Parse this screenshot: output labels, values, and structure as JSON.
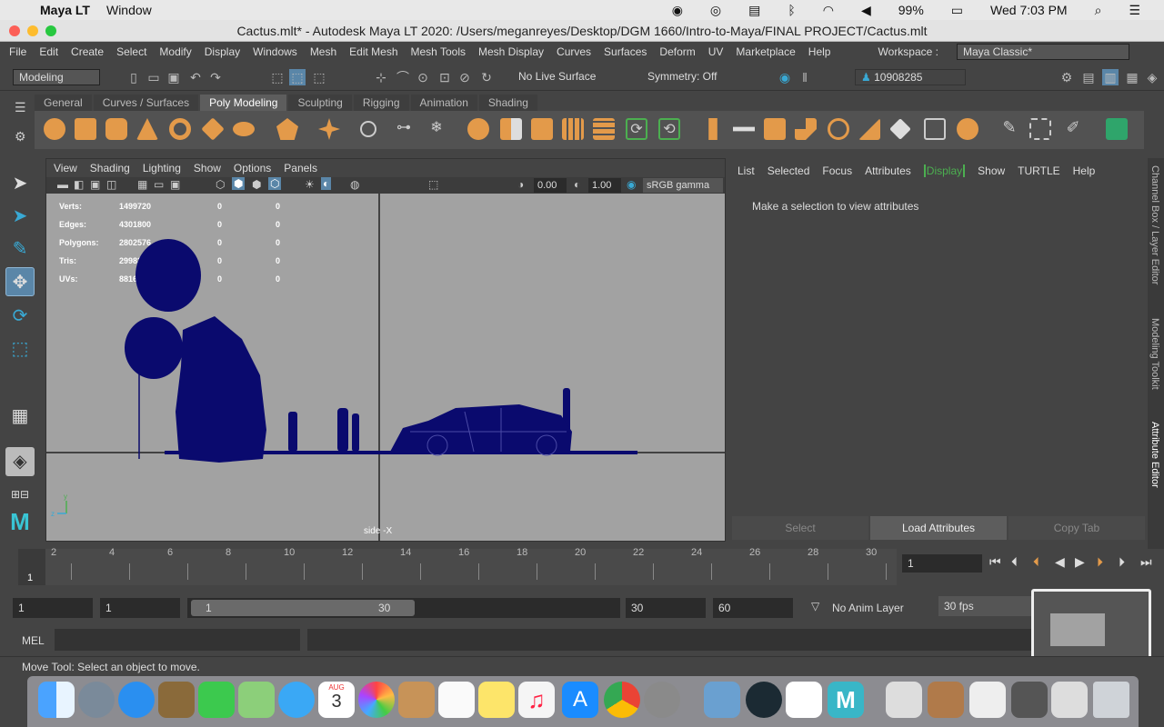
{
  "macbar": {
    "app": "Maya LT",
    "menu": [
      "Window"
    ],
    "battery": "99%",
    "clock": "Wed 7:03 PM"
  },
  "window": {
    "title": "Cactus.mlt* - Autodesk Maya LT 2020: /Users/meganreyes/Desktop/DGM 1660/Intro-to-Maya/FINAL PROJECT/Cactus.mlt"
  },
  "menubar": {
    "items": [
      "File",
      "Edit",
      "Create",
      "Select",
      "Modify",
      "Display",
      "Windows",
      "Mesh",
      "Edit Mesh",
      "Mesh Tools",
      "Mesh Display",
      "Curves",
      "Surfaces",
      "Deform",
      "UV",
      "Marketplace",
      "Help"
    ],
    "workspace_label": "Workspace :",
    "workspace_value": "Maya Classic*"
  },
  "statusline": {
    "mode": "Modeling",
    "live_surface": "No Live Surface",
    "symmetry": "Symmetry: Off",
    "user": "10908285"
  },
  "shelf": {
    "tabs": [
      "General",
      "Curves / Surfaces",
      "Poly Modeling",
      "Sculpting",
      "Rigging",
      "Animation",
      "Shading"
    ],
    "active_tab": "Poly Modeling"
  },
  "viewport": {
    "menu": [
      "View",
      "Shading",
      "Lighting",
      "Show",
      "Options",
      "Panels"
    ],
    "exposure": "0.00",
    "gamma": "1.00",
    "colorspace": "sRGB gamma",
    "camera_label": "side -X",
    "hud": [
      {
        "label": "Verts:",
        "value": "1499720",
        "c1": "0",
        "c2": "0"
      },
      {
        "label": "Edges:",
        "value": "4301800",
        "c1": "0",
        "c2": "0"
      },
      {
        "label": "Polygons:",
        "value": "2802576",
        "c1": "0",
        "c2": "0"
      },
      {
        "label": "Tris:",
        "value": "2998320",
        "c1": "0",
        "c2": "0"
      },
      {
        "label": "UVs:",
        "value": "8816",
        "c1": "0",
        "c2": "0"
      }
    ]
  },
  "attribute_editor": {
    "menu": [
      "List",
      "Selected",
      "Focus",
      "Attributes",
      "Display",
      "Show",
      "TURTLE",
      "Help"
    ],
    "message": "Make a selection to view attributes",
    "buttons": [
      "Select",
      "Load Attributes",
      "Copy Tab"
    ],
    "side_tabs": [
      "Channel Box / Layer Editor",
      "Modeling Toolkit",
      "Attribute Editor"
    ]
  },
  "timeline": {
    "ticks": [
      "2",
      "4",
      "6",
      "8",
      "10",
      "12",
      "14",
      "16",
      "18",
      "20",
      "22",
      "24",
      "26",
      "28",
      "30"
    ],
    "current_frame_marker": "1",
    "current_frame": "1"
  },
  "range": {
    "start": "1",
    "playback_start": "1",
    "slider_min": "1",
    "slider_max": "30",
    "playback_end": "30",
    "end": "60",
    "anim_layer": "No Anim Layer",
    "fps": "30 fps"
  },
  "commandline": {
    "mode": "MEL"
  },
  "helpline": {
    "text": "Move Tool: Select an object to move."
  },
  "dock": {
    "calendar_month": "AUG",
    "calendar_day": "3"
  }
}
